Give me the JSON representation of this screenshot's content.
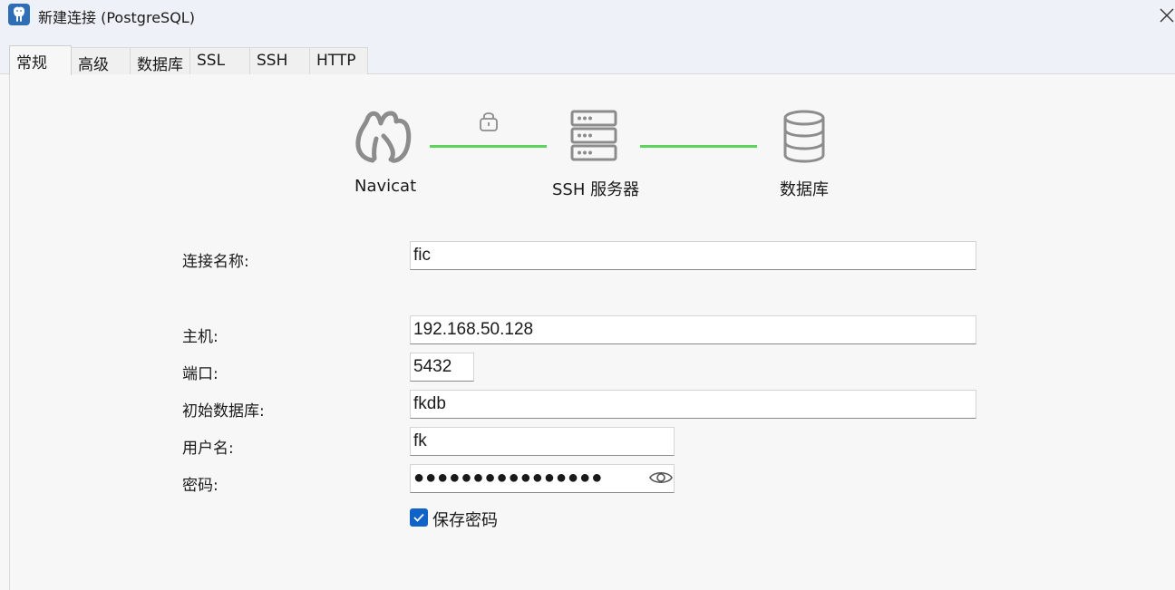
{
  "window": {
    "title": "新建连接 (PostgreSQL)",
    "app_icon": "postgresql-elephant-icon",
    "close_icon": "close-icon"
  },
  "tabs": [
    {
      "label": "常规",
      "active": true
    },
    {
      "label": "高级",
      "active": false
    },
    {
      "label": "数据库",
      "active": false
    },
    {
      "label": "SSL",
      "active": false
    },
    {
      "label": "SSH",
      "active": false
    },
    {
      "label": "HTTP",
      "active": false
    }
  ],
  "diagram": {
    "nodes": [
      {
        "label": "Navicat",
        "icon": "navicat-logo-icon"
      },
      {
        "label": "SSH 服务器",
        "icon": "server-icon"
      },
      {
        "label": "数据库",
        "icon": "database-icon"
      }
    ],
    "lock_icon": "lock-icon",
    "link_color": "#5cd35a"
  },
  "form": {
    "connection_name": {
      "label": "连接名称:",
      "value": "fic"
    },
    "host": {
      "label": "主机:",
      "value": "192.168.50.128"
    },
    "port": {
      "label": "端口:",
      "value": "5432"
    },
    "initial_db": {
      "label": "初始数据库:",
      "value": "fkdb"
    },
    "username": {
      "label": "用户名:",
      "value": "fk"
    },
    "password": {
      "label": "密码:",
      "value": "●●●●●●●●●●●●●●●●",
      "reveal_icon": "eye-icon"
    },
    "save_password": {
      "label": "保存密码",
      "checked": true
    }
  },
  "colors": {
    "accent": "#0f62c8",
    "titlebar_bg": "#eef1f8",
    "content_bg": "#f7f7f7",
    "icon_gray": "#8c8c8c"
  }
}
